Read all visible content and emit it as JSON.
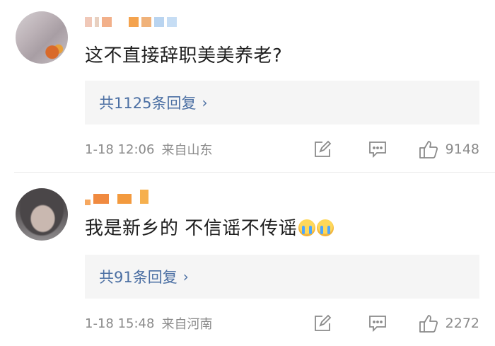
{
  "comments": [
    {
      "avatar_icon": "blurred-avatar",
      "username_pixels": [
        "#f0c8b8",
        "#e8d0c0",
        "#f2b08a",
        "#f4a34e",
        "#f0b27a",
        "#b9d4f0",
        "#c6ddf4"
      ],
      "text": "这不直接辞职美美养老?",
      "emojis": [],
      "reply_link": "共1125条回复",
      "time": "1-18 12:06",
      "location": "来自山东",
      "likes": "9148"
    },
    {
      "avatar_icon": "blurred-avatar",
      "username_pixels": [
        "#f6a860",
        "#f08a40",
        "#ffffff",
        "#f39a3e",
        "#ffffff",
        "#f6b04e"
      ],
      "text": "我是新乡的 不信谣不传谣",
      "emojis": [
        "crying-emoji",
        "crying-emoji"
      ],
      "reply_link": "共91条回复",
      "time": "1-18 15:48",
      "location": "来自河南",
      "likes": "2272"
    }
  ],
  "icons": {
    "chevron": "chevron-right-icon",
    "edit": "edit-icon",
    "reply": "comment-icon",
    "like": "thumbs-up-icon"
  },
  "colors": {
    "link": "#4b6fa3",
    "meta": "#8a8a8a",
    "reply_bg": "#f5f5f5",
    "text": "#1f1f1f"
  }
}
